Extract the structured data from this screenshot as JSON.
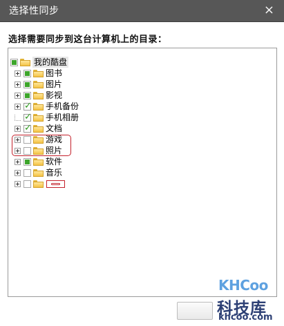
{
  "dialog": {
    "title": "选择性同步",
    "close_glyph": "×",
    "prompt": "选择需要同步到这台计算机上的目录：",
    "ok_label": ""
  },
  "tree": {
    "root": {
      "label": "我的酷盘",
      "state": "partial"
    },
    "items": [
      {
        "label": "图书",
        "state": "partial",
        "expandable": true
      },
      {
        "label": "图片",
        "state": "partial",
        "expandable": true
      },
      {
        "label": "影视",
        "state": "partial",
        "expandable": true
      },
      {
        "label": "手机备份",
        "state": "checked",
        "expandable": true
      },
      {
        "label": "手机相册",
        "state": "checked",
        "expandable": false
      },
      {
        "label": "文档",
        "state": "checked",
        "expandable": true
      },
      {
        "label": "游戏",
        "state": "unchecked",
        "expandable": true
      },
      {
        "label": "照片",
        "state": "unchecked",
        "expandable": true
      },
      {
        "label": "软件",
        "state": "partial",
        "expandable": true
      },
      {
        "label": "音乐",
        "state": "unchecked",
        "expandable": true
      },
      {
        "label": "",
        "state": "unchecked",
        "expandable": true
      }
    ]
  },
  "watermark": {
    "logo": "KHCoo",
    "name": "科技库",
    "url": "khcoo.com"
  },
  "colors": {
    "titlebar": "#575757",
    "check_green": "#3da52b",
    "highlight_red": "#c3202a",
    "folder_yellow": "#f4c446"
  }
}
